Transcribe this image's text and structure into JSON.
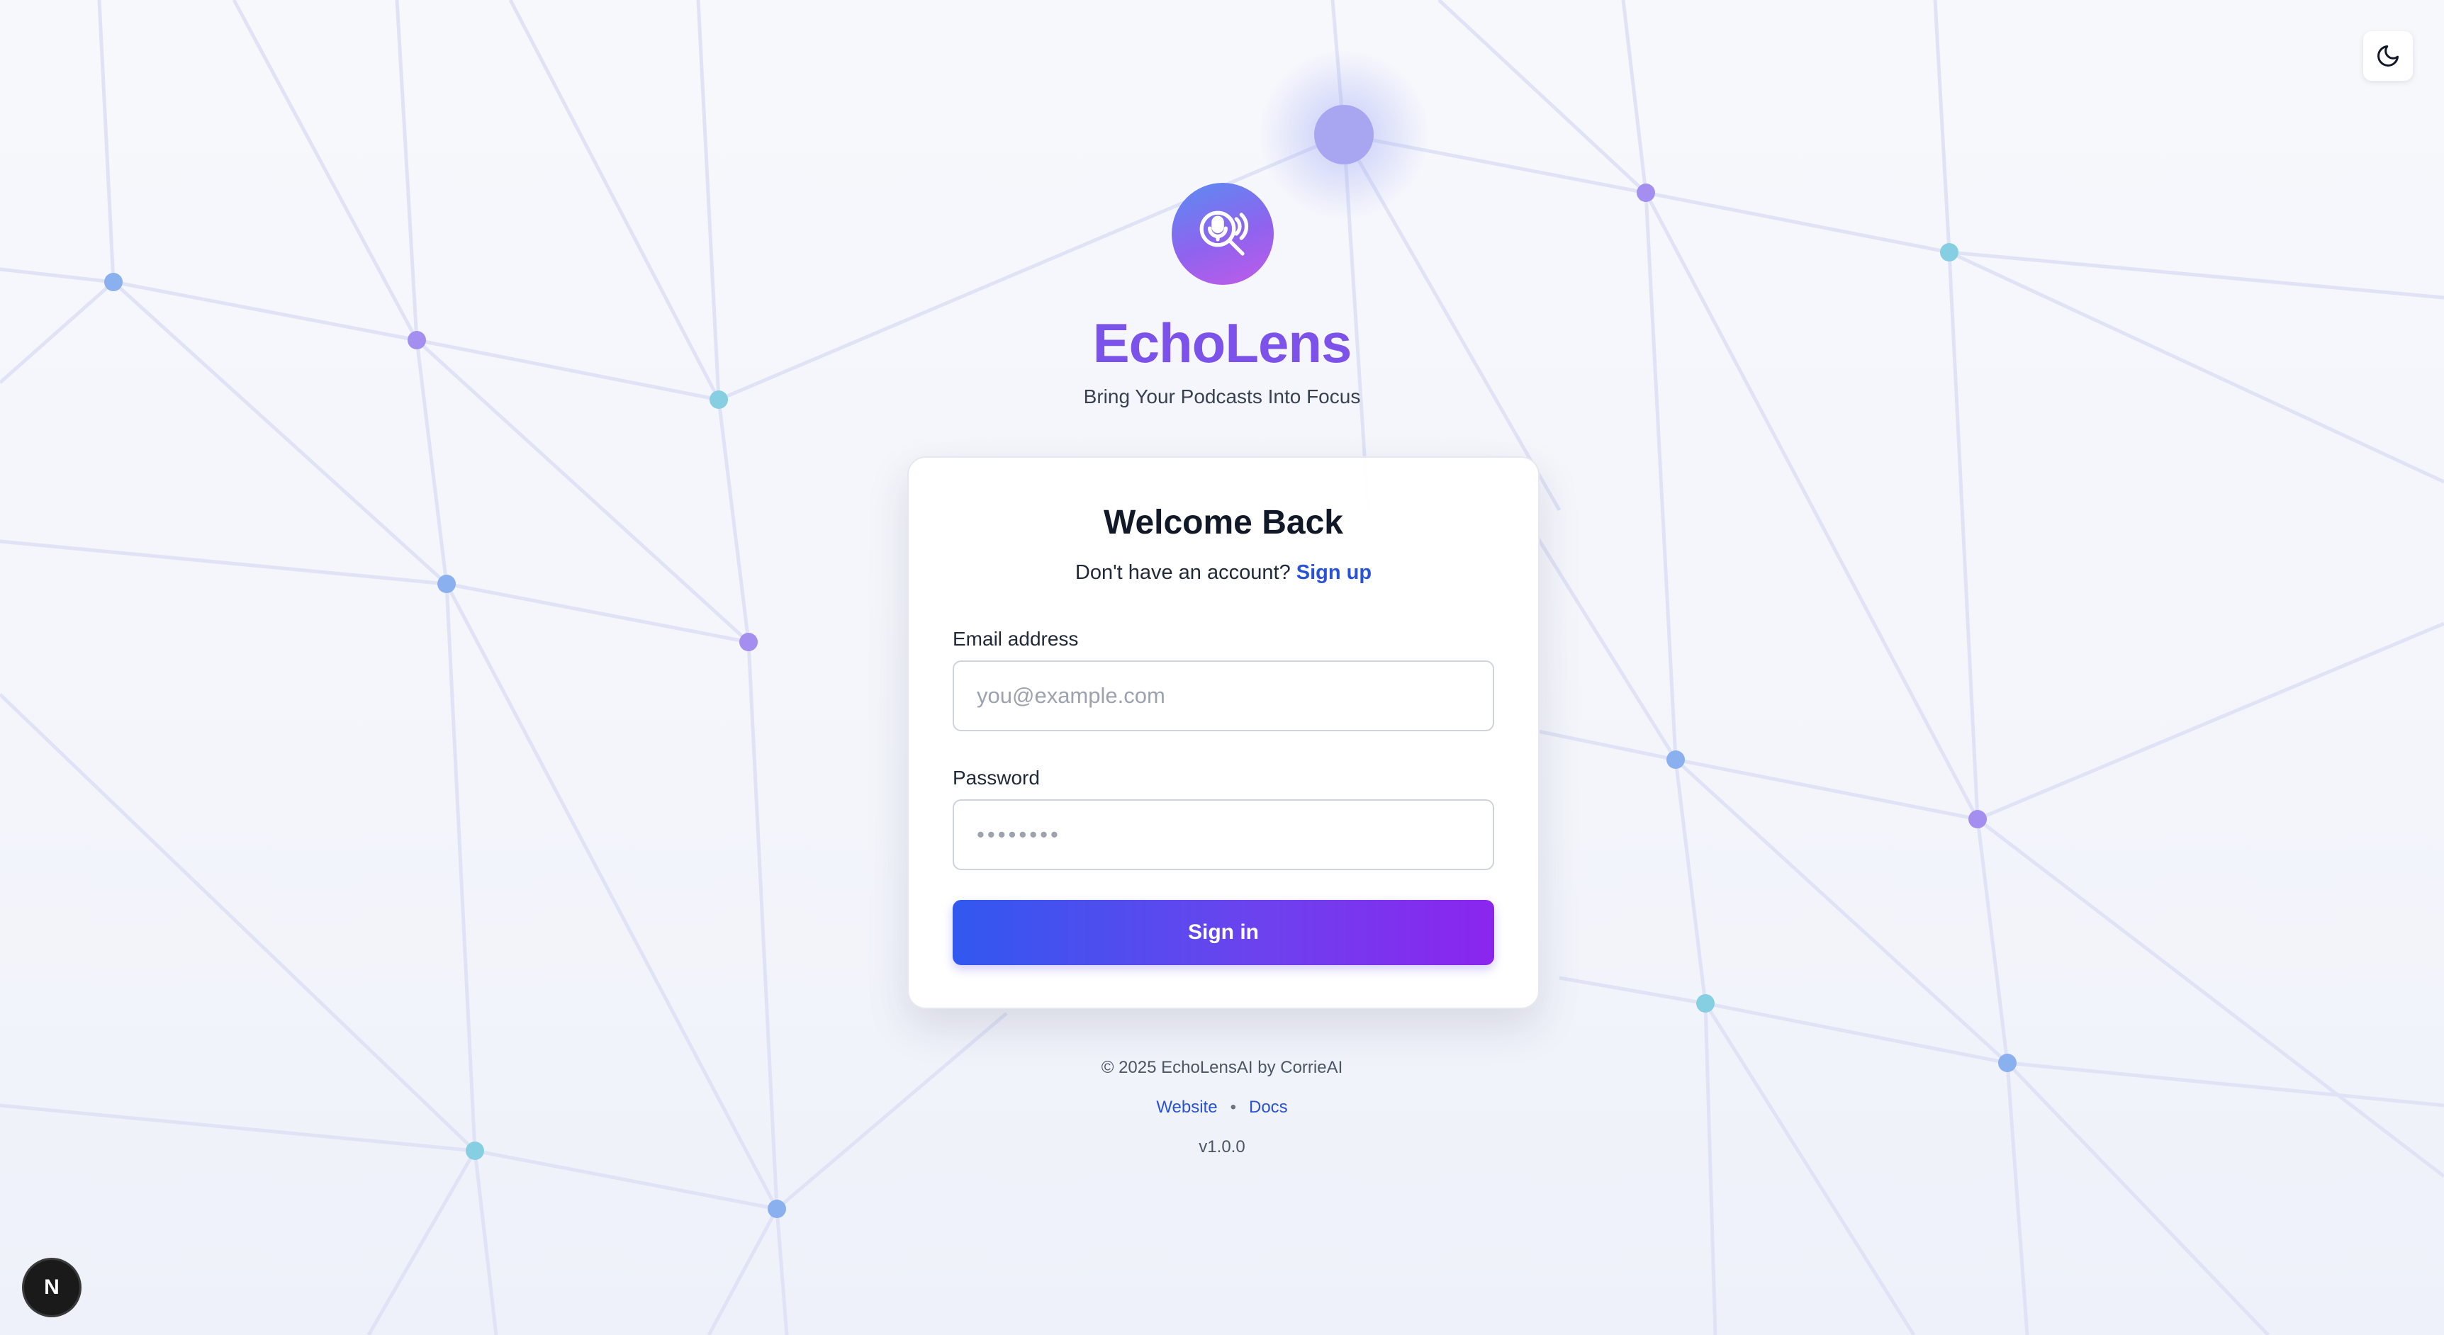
{
  "app": {
    "name": "EchoLens",
    "tagline": "Bring Your Podcasts Into Focus"
  },
  "icons": {
    "theme_toggle": "moon-icon",
    "logo": "podcast-microphone-magnifier-icon",
    "dev_badge_letter": "N"
  },
  "colors": {
    "brand_gradient_start": "#3158ef",
    "brand_gradient_end": "#8b25ee",
    "brand_title": "#7a4fe6",
    "link": "#2a52d6",
    "node_blue": "#8ab0f0",
    "node_purple": "#a48ff0",
    "node_teal": "#86cfe3"
  },
  "login": {
    "title": "Welcome Back",
    "no_account_text": "Don't have an account?",
    "signup_label": "Sign up",
    "email_label": "Email address",
    "email_placeholder": "you@example.com",
    "email_value": "",
    "password_label": "Password",
    "password_placeholder": "••••••••",
    "password_value": "",
    "submit_label": "Sign in"
  },
  "footer": {
    "copyright": "© 2025 EchoLensAI by CorrieAI",
    "links": [
      "Website",
      "Docs"
    ],
    "separator": "•",
    "version": "v1.0.0"
  }
}
